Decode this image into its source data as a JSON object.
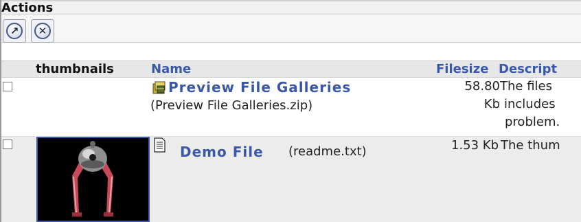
{
  "actions": {
    "title": "Actions",
    "buttons": [
      {
        "icon": "arrow-up-right-icon",
        "glyph": "↗"
      },
      {
        "icon": "close-icon",
        "glyph": "✕"
      }
    ]
  },
  "table": {
    "headers": {
      "thumbnails": "thumbnails",
      "name": "Name",
      "filesize": "Filesize",
      "description": "Descript"
    },
    "rows": [
      {
        "name": "Preview File Galleries",
        "filename": "(Preview File Galleries.zip)",
        "filesize_line1": "58.80",
        "filesize_line2": "Kb",
        "desc_line1": "The files",
        "desc_line2": "includes",
        "desc_line3": "problem.",
        "icon": "package-icon"
      },
      {
        "name": "Demo File",
        "filename": "(readme.txt)",
        "filesize": "1.53 Kb",
        "desc_line1": "The thum",
        "icon": "text-file-icon",
        "thumbnail": "robot-thumbnail-icon"
      }
    ]
  },
  "colors": {
    "link": "#3a57a8",
    "header_bg": "#e7e7e7",
    "row_alt_bg": "#ececec"
  }
}
